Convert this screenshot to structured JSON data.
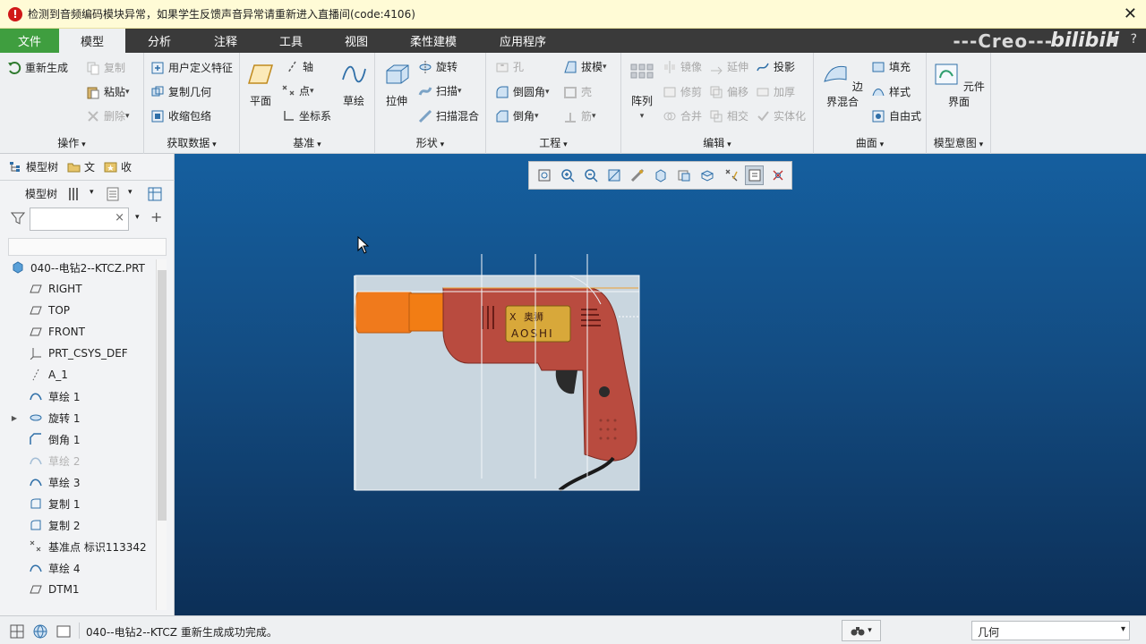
{
  "warning": {
    "message": "检测到音频编码模块异常，如果学生反馈声音异常请重新进入直播间(code:4106)",
    "icon": "error-icon",
    "close": "✕"
  },
  "tabs": [
    "文件",
    "模型",
    "分析",
    "注释",
    "工具",
    "视图",
    "柔性建模",
    "应用程序"
  ],
  "brand": "---Creo---",
  "watermark": "bilibili",
  "window_help": "?",
  "ribbon": {
    "operations": {
      "title": "操作",
      "regenerate": "重新生成",
      "copy": "复制",
      "paste": "粘贴",
      "delete": "删除"
    },
    "get_data": {
      "title": "获取数据",
      "udf": "用户定义特征",
      "copy_geom": "复制几何",
      "shrinkwrap": "收缩包络"
    },
    "datum": {
      "title": "基准",
      "plane": "平面",
      "axis": "轴",
      "point": "点",
      "csys": "坐标系",
      "sketch": "草绘"
    },
    "shapes": {
      "title": "形状",
      "extrude": "拉伸",
      "revolve": "旋转",
      "sweep": "扫描",
      "swept_blend": "扫描混合"
    },
    "engineering": {
      "title": "工程",
      "hole": "孔",
      "draft": "拔模",
      "round": "倒圆角",
      "shell": "壳",
      "chamfer": "倒角",
      "rib": "筋"
    },
    "editing": {
      "title": "编辑",
      "pattern": "阵列",
      "mirror": "镜像",
      "extend": "延伸",
      "project": "投影",
      "trim": "修剪",
      "offset": "偏移",
      "thicken": "加厚",
      "merge": "合并",
      "intersect": "相交",
      "solidify": "实体化"
    },
    "surfaces": {
      "title": "曲面",
      "boundary_blend": "边界混合",
      "fill": "填充",
      "style": "样式",
      "freestyle": "自由式"
    },
    "model_intent": {
      "title": "模型意图",
      "component_interface": "元件界面"
    }
  },
  "panel": {
    "tabs": [
      "模型树",
      "文",
      "收"
    ],
    "toolbar_label": "模型树",
    "search_value": "",
    "clear": "×",
    "tree": [
      {
        "label": "040--电钻2--KTCZ.PRT",
        "icon": "part-icon",
        "disabled": false
      },
      {
        "label": "RIGHT",
        "icon": "datum-plane-icon",
        "disabled": false
      },
      {
        "label": "TOP",
        "icon": "datum-plane-icon",
        "disabled": false
      },
      {
        "label": "FRONT",
        "icon": "datum-plane-icon",
        "disabled": false
      },
      {
        "label": "PRT_CSYS_DEF",
        "icon": "csys-icon",
        "disabled": false
      },
      {
        "label": "A_1",
        "icon": "axis-icon",
        "disabled": false
      },
      {
        "label": "草绘 1",
        "icon": "sketch-icon",
        "disabled": false
      },
      {
        "label": "旋转 1",
        "icon": "revolve-icon",
        "disabled": false
      },
      {
        "label": "倒角 1",
        "icon": "chamfer-icon",
        "disabled": false
      },
      {
        "label": "草绘 2",
        "icon": "sketch-icon",
        "disabled": true
      },
      {
        "label": "草绘 3",
        "icon": "sketch-icon",
        "disabled": false
      },
      {
        "label": "复制 1",
        "icon": "copy-icon",
        "disabled": false
      },
      {
        "label": "复制 2",
        "icon": "copy-icon",
        "disabled": false
      },
      {
        "label": "基准点 标识113342",
        "icon": "datum-point-icon",
        "disabled": false
      },
      {
        "label": "草绘 4",
        "icon": "sketch-icon",
        "disabled": false
      },
      {
        "label": "DTM1",
        "icon": "datum-plane-icon",
        "disabled": false
      }
    ]
  },
  "viewport": {
    "drill_label_cn": "奥狮",
    "drill_label_en": "AOSHI",
    "drill_mark": "X"
  },
  "status": {
    "message": "040--电钻2--KTCZ 重新生成成功完成。",
    "filter": "几何"
  },
  "colors": {
    "file_tab": "#3f9e3f",
    "accent": "#2f6fa8",
    "viewport_top": "#155f9f",
    "viewport_bottom": "#0c2f57",
    "warning_bg": "#fffbd6"
  }
}
